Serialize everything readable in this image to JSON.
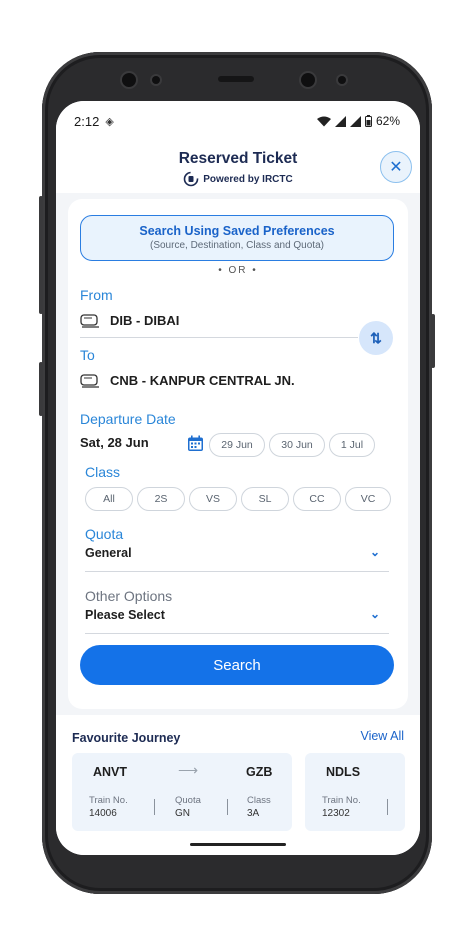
{
  "status_bar": {
    "time": "2:12",
    "battery": "62%"
  },
  "header": {
    "title": "Reserved Ticket",
    "powered_by": "Powered by IRCTC"
  },
  "prefs": {
    "title": "Search Using Saved Preferences",
    "subtitle": "(Source, Destination, Class and Quota)",
    "or": "• OR •"
  },
  "from": {
    "label": "From",
    "value": "DIB - DIBAI"
  },
  "to": {
    "label": "To",
    "value": "CNB - KANPUR CENTRAL JN."
  },
  "departure": {
    "label": "Departure Date",
    "selected": "Sat, 28 Jun",
    "chips": [
      "29 Jun",
      "30 Jun",
      "1 Jul"
    ]
  },
  "class": {
    "label": "Class",
    "options": [
      "All",
      "2S",
      "VS",
      "SL",
      "CC",
      "VC"
    ]
  },
  "quota": {
    "label": "Quota",
    "value": "General"
  },
  "other_options": {
    "label": "Other Options",
    "value": "Please Select"
  },
  "search_label": "Search",
  "favourite": {
    "title": "Favourite Journey",
    "view_all": "View All",
    "journeys": [
      {
        "from": "ANVT",
        "to": "GZB",
        "train_no_label": "Train No.",
        "train_no": "14006",
        "quota_label": "Quota",
        "quota": "GN",
        "class_label": "Class",
        "class": "3A"
      },
      {
        "from": "NDLS",
        "train_no_label": "Train No.",
        "train_no": "12302"
      }
    ]
  },
  "colors": {
    "primary": "#1472e8",
    "accent_blue": "#2a86d8",
    "title_navy": "#1d2b53"
  },
  "icons": [
    "irctc-logo-icon",
    "train-icon",
    "swap-icon",
    "calendar-icon",
    "chevron-down-icon",
    "close-icon",
    "arrow-right-icon"
  ]
}
